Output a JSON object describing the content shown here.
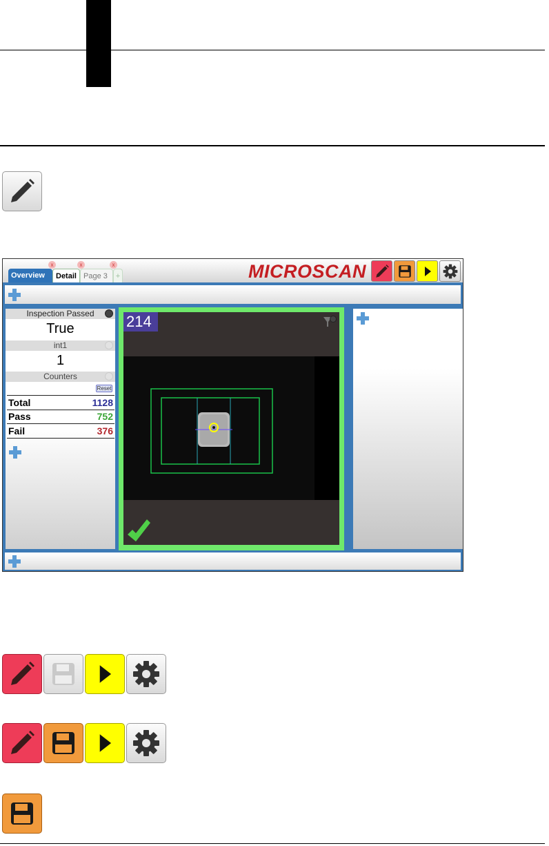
{
  "app": {
    "tabs": [
      {
        "label": "Overview"
      },
      {
        "label": "Detail"
      },
      {
        "label": "Page 3"
      }
    ],
    "add_tab_label": "+",
    "logo_text": "MICROSCAN",
    "toolbar_icons": [
      "pencil-icon",
      "save-icon",
      "play-icon",
      "gear-icon"
    ]
  },
  "results": {
    "inspection_label": "Inspection Passed",
    "inspection_value": "True",
    "int1_label": "int1",
    "int1_value": "1",
    "counters_label": "Counters",
    "reset_label": "Reset",
    "rows": [
      {
        "label": "Total",
        "value": "1128",
        "color": "#2b2e96"
      },
      {
        "label": "Pass",
        "value": "752",
        "color": "#3aa535"
      },
      {
        "label": "Fail",
        "value": "376",
        "color": "#b2262c"
      }
    ]
  },
  "image_view": {
    "counter": "214",
    "status": "pass-check-icon"
  },
  "colors": {
    "edit": "#ee3c58",
    "save": "#f19a3c",
    "run": "#ffff00",
    "pass_frame": "#6fe86b",
    "tab_active": "#2f73b8",
    "logo": "#c41e22"
  }
}
